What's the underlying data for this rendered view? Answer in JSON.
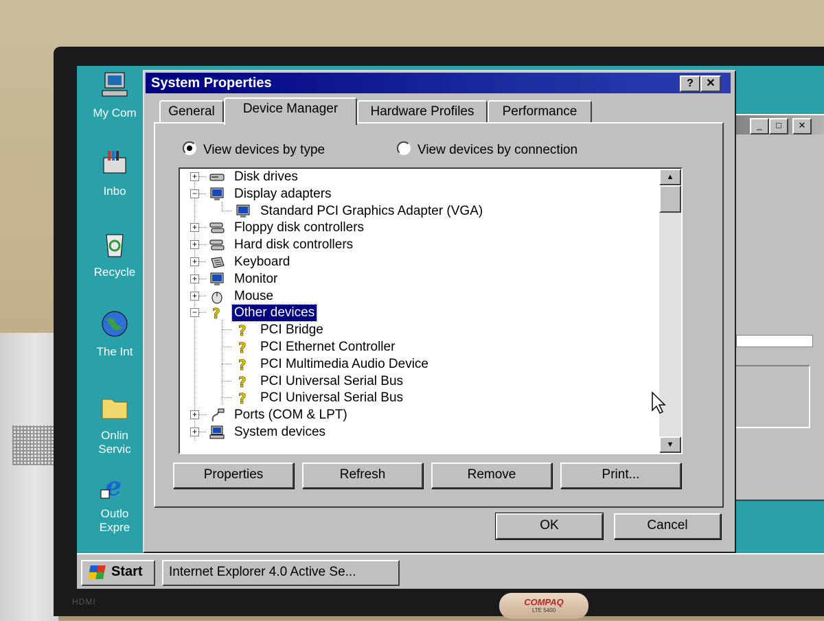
{
  "desktop": {
    "icons": [
      {
        "label": "My Com",
        "icon": "my-computer-icon"
      },
      {
        "label": "Inbo",
        "icon": "inbox-icon"
      },
      {
        "label": "Recycle",
        "icon": "recycle-bin-icon"
      },
      {
        "label": "The Int",
        "icon": "internet-globe-icon"
      },
      {
        "label_line1": "Onlin",
        "label_line2": "Servic",
        "icon": "folder-icon"
      },
      {
        "label_line1": "Outlo",
        "label_line2": "Expre",
        "icon": "outlook-express-icon"
      }
    ]
  },
  "dialog": {
    "title": "System Properties",
    "help_label": "?",
    "close_label": "✕",
    "tabs": [
      {
        "label": "General",
        "active": false
      },
      {
        "label": "Device Manager",
        "active": true
      },
      {
        "label": "Hardware Profiles",
        "active": false
      },
      {
        "label": "Performance",
        "active": false
      }
    ],
    "view_options": [
      {
        "label": "View devices by type",
        "selected": true
      },
      {
        "label": "View devices by connection",
        "selected": false
      }
    ],
    "tree": [
      {
        "level": 0,
        "expander": "+",
        "label": "Disk drives",
        "icon": "disk-drive-icon"
      },
      {
        "level": 0,
        "expander": "-",
        "label": "Display adapters",
        "icon": "display-monitor-icon"
      },
      {
        "level": 1,
        "label": "Standard PCI Graphics Adapter (VGA)",
        "icon": "display-monitor-icon"
      },
      {
        "level": 0,
        "expander": "+",
        "label": "Floppy disk controllers",
        "icon": "controller-icon"
      },
      {
        "level": 0,
        "expander": "+",
        "label": "Hard disk controllers",
        "icon": "controller-icon"
      },
      {
        "level": 0,
        "expander": "+",
        "label": "Keyboard",
        "icon": "keyboard-icon"
      },
      {
        "level": 0,
        "expander": "+",
        "label": "Monitor",
        "icon": "display-monitor-icon"
      },
      {
        "level": 0,
        "expander": "+",
        "label": "Mouse",
        "icon": "mouse-icon"
      },
      {
        "level": 0,
        "expander": "-",
        "label": "Other devices",
        "icon": "question-mark-icon",
        "selected": true
      },
      {
        "level": 1,
        "label": "PCI Bridge",
        "icon": "question-mark-icon"
      },
      {
        "level": 1,
        "label": "PCI Ethernet Controller",
        "icon": "question-mark-icon"
      },
      {
        "level": 1,
        "label": "PCI Multimedia Audio Device",
        "icon": "question-mark-icon"
      },
      {
        "level": 1,
        "label": "PCI Universal Serial Bus",
        "icon": "question-mark-icon"
      },
      {
        "level": 1,
        "label": "PCI Universal Serial Bus",
        "icon": "question-mark-icon"
      },
      {
        "level": 0,
        "expander": "+",
        "label": "Ports (COM & LPT)",
        "icon": "port-plug-icon"
      },
      {
        "level": 0,
        "expander": "+",
        "label": "System devices",
        "icon": "computer-icon"
      }
    ],
    "buttons": {
      "properties": "Properties",
      "refresh": "Refresh",
      "remove": "Remove",
      "print": "Print...",
      "ok": "OK",
      "cancel": "Cancel"
    }
  },
  "background_window": {
    "minimize": "_",
    "maximize": "□",
    "close": "✕"
  },
  "taskbar": {
    "start_label": "Start",
    "tasks": [
      "Internet Explorer 4.0 Active Se..."
    ]
  },
  "bezel": {
    "port_label": "HDMI",
    "brand": "COMPAQ",
    "model": "LTE 5400"
  },
  "colors": {
    "desktop": "#2aa1a9",
    "title_bar": "#000080",
    "selection": "#000080",
    "face": "#c0c0c0"
  }
}
